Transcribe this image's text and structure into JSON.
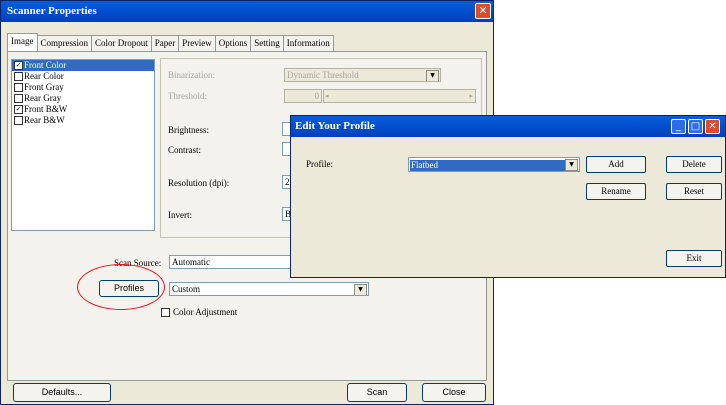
{
  "window": {
    "title": "Scanner Properties",
    "tabs": [
      "Image",
      "Compression",
      "Color Dropout",
      "Paper",
      "Preview",
      "Options",
      "Setting",
      "Information"
    ],
    "image_types": [
      {
        "label": "Front Color",
        "checked": true,
        "selected": true
      },
      {
        "label": "Rear Color",
        "checked": false,
        "selected": false
      },
      {
        "label": "Front Gray",
        "checked": false,
        "selected": false
      },
      {
        "label": "Rear Gray",
        "checked": false,
        "selected": false
      },
      {
        "label": "Front B&W",
        "checked": true,
        "selected": false
      },
      {
        "label": "Rear B&W",
        "checked": false,
        "selected": false
      }
    ],
    "binarization_label": "Binarization:",
    "binarization_value": "Dynamic Threshold",
    "threshold_label": "Threshold:",
    "threshold_value": "0",
    "brightness_label": "Brightness:",
    "contrast_label": "Contrast:",
    "resolution_label": "Resolution (dpi):",
    "resolution_value": "2",
    "invert_label": "Invert:",
    "invert_value": "B",
    "scan_source_label": "Scan Source:",
    "scan_source_value": "Automatic",
    "profiles_button": "Profiles",
    "profile_value": "Custom",
    "color_adjustment_label": "Color Adjustment",
    "defaults_button": "Defaults...",
    "scan_button": "Scan",
    "close_button": "Close"
  },
  "dialog": {
    "title": "Edit Your Profile",
    "profile_label": "Profile:",
    "profile_value": "Flatbed",
    "add_button": "Add",
    "delete_button": "Delete",
    "rename_button": "Rename",
    "reset_button": "Reset",
    "exit_button": "Exit"
  },
  "colors": {
    "titlebar": "#0054e3",
    "highlight": "#316ac5",
    "annotation": "#e8141c"
  }
}
